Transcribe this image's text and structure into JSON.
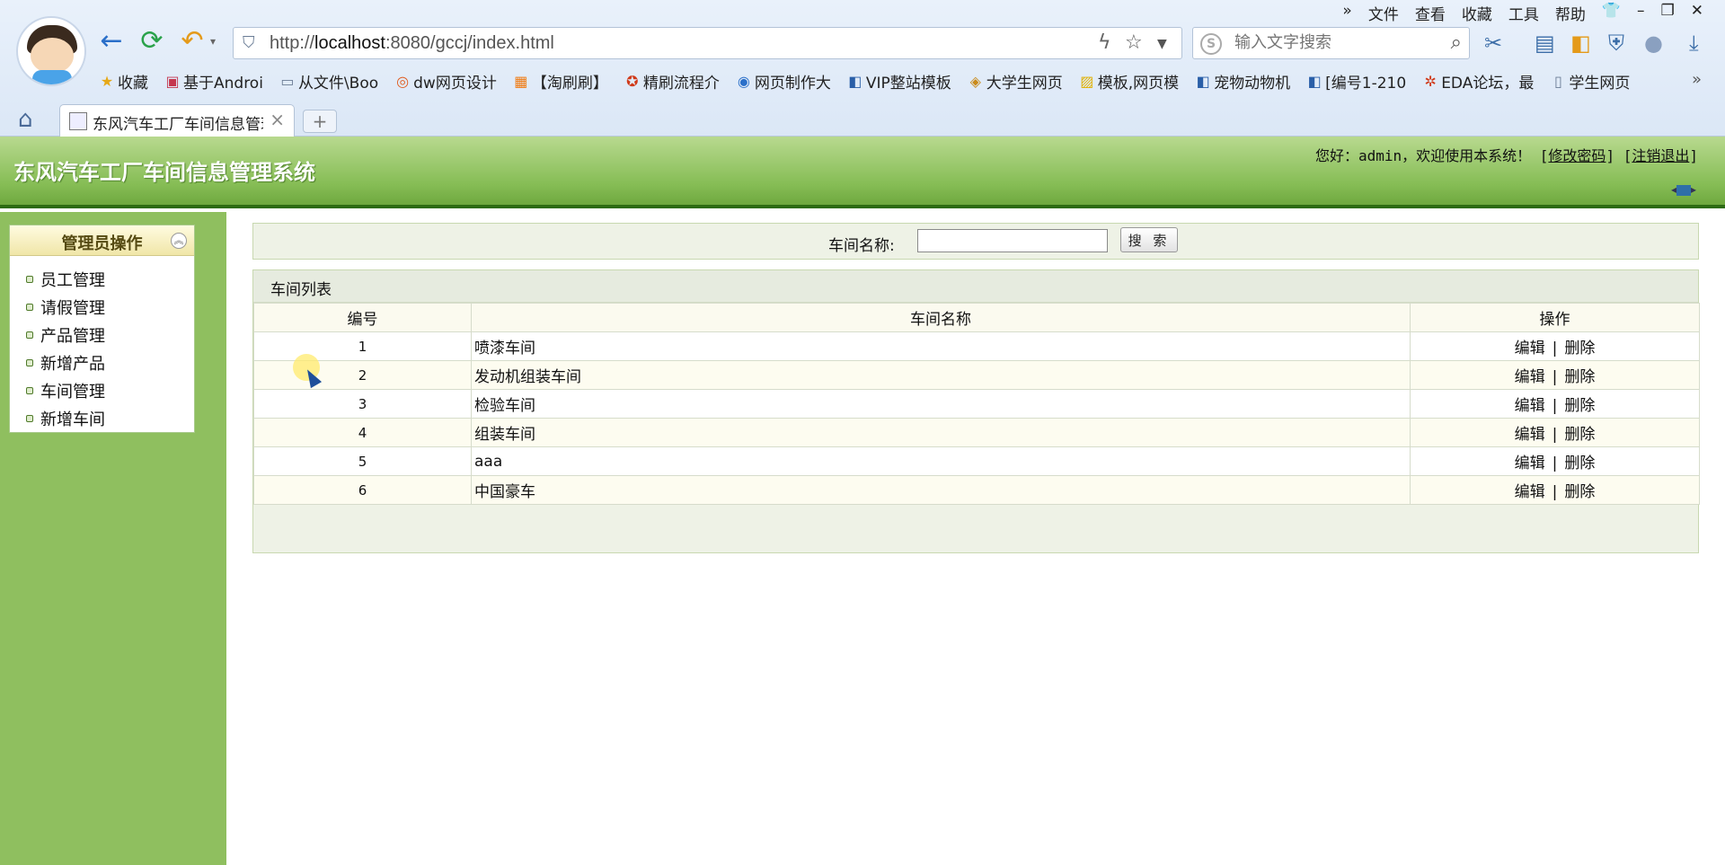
{
  "browser": {
    "menu": [
      "文件",
      "查看",
      "收藏",
      "工具",
      "帮助"
    ],
    "address": {
      "prefix": "http://",
      "host": "localhost",
      "rest": ":8080/gccj/index.html"
    },
    "search_placeholder": "输入文字搜索",
    "bookmarks": [
      {
        "label": "收藏",
        "icon": "star-icon",
        "color": "#e6a817"
      },
      {
        "label": "基于Androi",
        "icon": "app-icon",
        "color": "#c4364e"
      },
      {
        "label": "从文件\\Boo",
        "icon": "folder-icon",
        "color": "#6a7c95"
      },
      {
        "label": "dw网页设计",
        "icon": "swirl-icon",
        "color": "#e05a1c"
      },
      {
        "label": "【淘刷刷】",
        "icon": "shop-icon",
        "color": "#f07a10"
      },
      {
        "label": "精刷流程介",
        "icon": "badge-icon",
        "color": "#d03a1a"
      },
      {
        "label": "网页制作大",
        "icon": "globe-icon",
        "color": "#2a6fc9"
      },
      {
        "label": "VIP整站模板",
        "icon": "d-icon",
        "color": "#2a5fa8"
      },
      {
        "label": "大学生网页",
        "icon": "cube-icon",
        "color": "#c98a1a"
      },
      {
        "label": "模板,网页模",
        "icon": "template-icon",
        "color": "#e0b000"
      },
      {
        "label": "宠物动物机",
        "icon": "d-icon",
        "color": "#2a5fa8"
      },
      {
        "label": "[编号1-210",
        "icon": "d-icon",
        "color": "#2a5fa8"
      },
      {
        "label": "EDA论坛，最",
        "icon": "flame-icon",
        "color": "#d03a1a"
      },
      {
        "label": "学生网页",
        "icon": "page-icon",
        "color": "#6a7c95"
      }
    ],
    "more_glyph": "»",
    "tab_title": "东风汽车工厂车间信息管理系统",
    "new_tab_glyph": "+"
  },
  "app": {
    "title": "东风汽车工厂车间信息管理系统",
    "welcome_prefix": "您好：admin，欢迎使用本系统！",
    "change_password": "修改密码",
    "logout": "注销退出"
  },
  "sidebar": {
    "title": "管理员操作",
    "items": [
      "员工管理",
      "请假管理",
      "产品管理",
      "新增产品",
      "车间管理",
      "新增车间"
    ]
  },
  "search": {
    "label": "车间名称:",
    "value": "",
    "button": "搜 索"
  },
  "list": {
    "title": "车间列表",
    "columns": [
      "编号",
      "车间名称",
      "操作"
    ],
    "edit_label": "编辑",
    "delete_label": "删除",
    "separator": "|",
    "rows": [
      {
        "id": "1",
        "name": "喷漆车间"
      },
      {
        "id": "2",
        "name": "发动机组装车间"
      },
      {
        "id": "3",
        "name": "检验车间"
      },
      {
        "id": "4",
        "name": "组装车间"
      },
      {
        "id": "5",
        "name": "aaa"
      },
      {
        "id": "6",
        "name": "中国豪车"
      }
    ]
  }
}
